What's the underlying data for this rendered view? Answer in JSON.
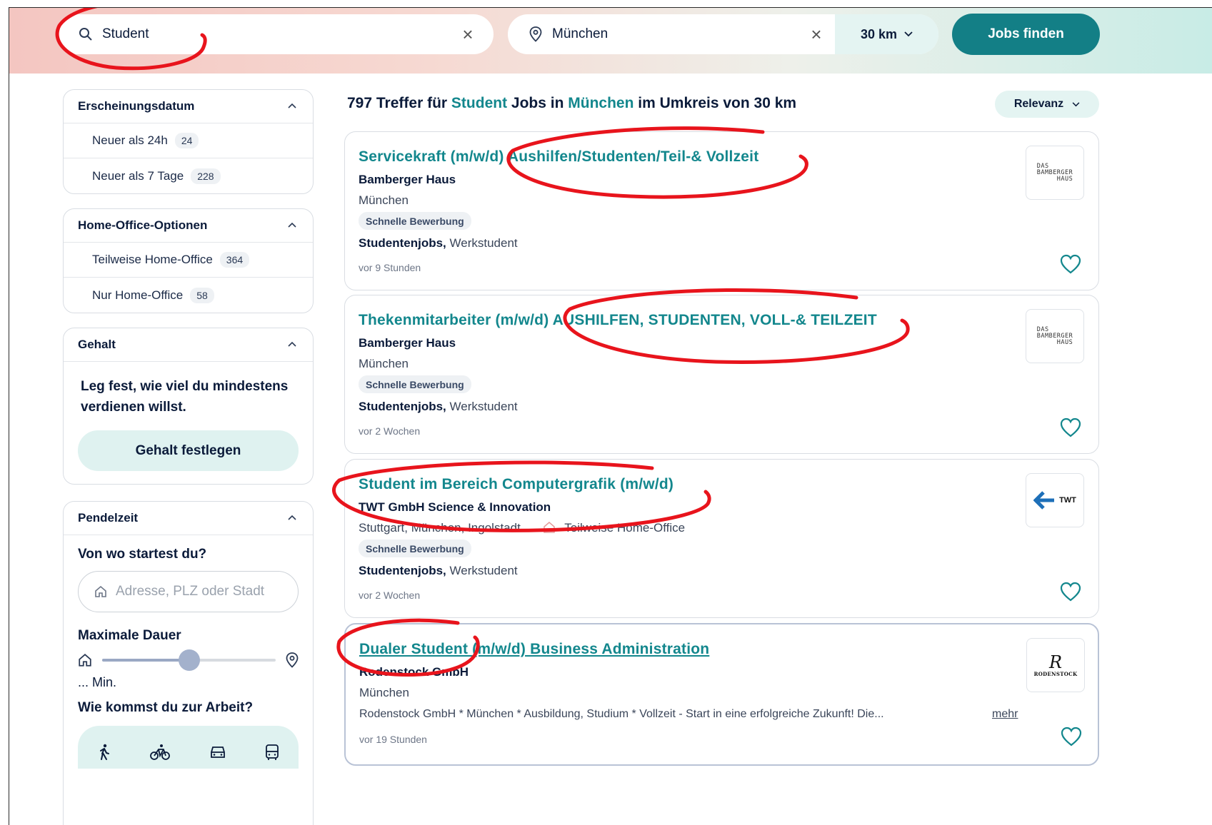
{
  "search": {
    "query": "Student",
    "location": "München",
    "radius": "30 km",
    "submit_label": "Jobs finden"
  },
  "filters": {
    "date": {
      "title": "Erscheinungsdatum",
      "options": [
        {
          "label": "Neuer als 24h",
          "count": "24"
        },
        {
          "label": "Neuer als 7 Tage",
          "count": "228"
        }
      ]
    },
    "home_office": {
      "title": "Home-Office-Optionen",
      "options": [
        {
          "label": "Teilweise Home-Office",
          "count": "364"
        },
        {
          "label": "Nur Home-Office",
          "count": "58"
        }
      ]
    },
    "salary": {
      "title": "Gehalt",
      "text": "Leg fest, wie viel du mindestens verdienen willst.",
      "button": "Gehalt festlegen"
    },
    "commute": {
      "title": "Pendelzeit",
      "start_label": "Von wo startest du?",
      "address_placeholder": "Adresse, PLZ oder Stadt",
      "duration_label": "Maximale Dauer",
      "duration_value": "... Min.",
      "duration_level": 0.5,
      "transport_label": "Wie kommst du zur Arbeit?"
    }
  },
  "results": {
    "count": "797",
    "text_treffer": "Treffer für",
    "query": "Student",
    "text_jobs_in": "Jobs in",
    "location": "München",
    "text_umkreis": "im Umkreis von 30 km",
    "sort_label": "Relevanz",
    "jobs": [
      {
        "title": "Servicekraft (m/w/d) Aushilfen/Studenten/Teil-& Vollzeit",
        "company": "Bamberger Haus",
        "location": "München",
        "badge": "Schnelle Bewerbung",
        "tag_bold": "Studentenjobs,",
        "tag_rest": "Werkstudent",
        "time": "vor 9 Stunden",
        "logo_lines": [
          "DAS",
          "BAMBERGER",
          "HAUS"
        ]
      },
      {
        "title": "Thekenmitarbeiter (m/w/d) AUSHILFEN, STUDENTEN, VOLL-& TEILZEIT",
        "company": "Bamberger Haus",
        "location": "München",
        "badge": "Schnelle Bewerbung",
        "tag_bold": "Studentenjobs,",
        "tag_rest": "Werkstudent",
        "time": "vor 2 Wochen",
        "logo_lines": [
          "DAS",
          "BAMBERGER",
          "HAUS"
        ]
      },
      {
        "title": "Student im Bereich Computergrafik (m/w/d)",
        "company": "TWT GmbH Science & Innovation",
        "location": "Stuttgart, München, Ingolstadt",
        "home_office": "Teilweise Home-Office",
        "badge": "Schnelle Bewerbung",
        "tag_bold": "Studentenjobs,",
        "tag_rest": "Werkstudent",
        "time": "vor 2 Wochen",
        "logo_text": "TWT"
      },
      {
        "title": "Dualer Student (m/w/d) Business Administration",
        "company": "Rodenstock GmbH",
        "location": "München",
        "description": "Rodenstock GmbH * München * Ausbildung, Studium * Vollzeit - Start in eine erfolgreiche Zukunft! Die...",
        "more": "mehr",
        "time": "vor 19 Stunden",
        "logo_letter": "R",
        "logo_word": "RODENSTOCK"
      }
    ]
  },
  "colors": {
    "accent": "#13878d",
    "button": "#137f86",
    "annotation": "#e8141c"
  }
}
